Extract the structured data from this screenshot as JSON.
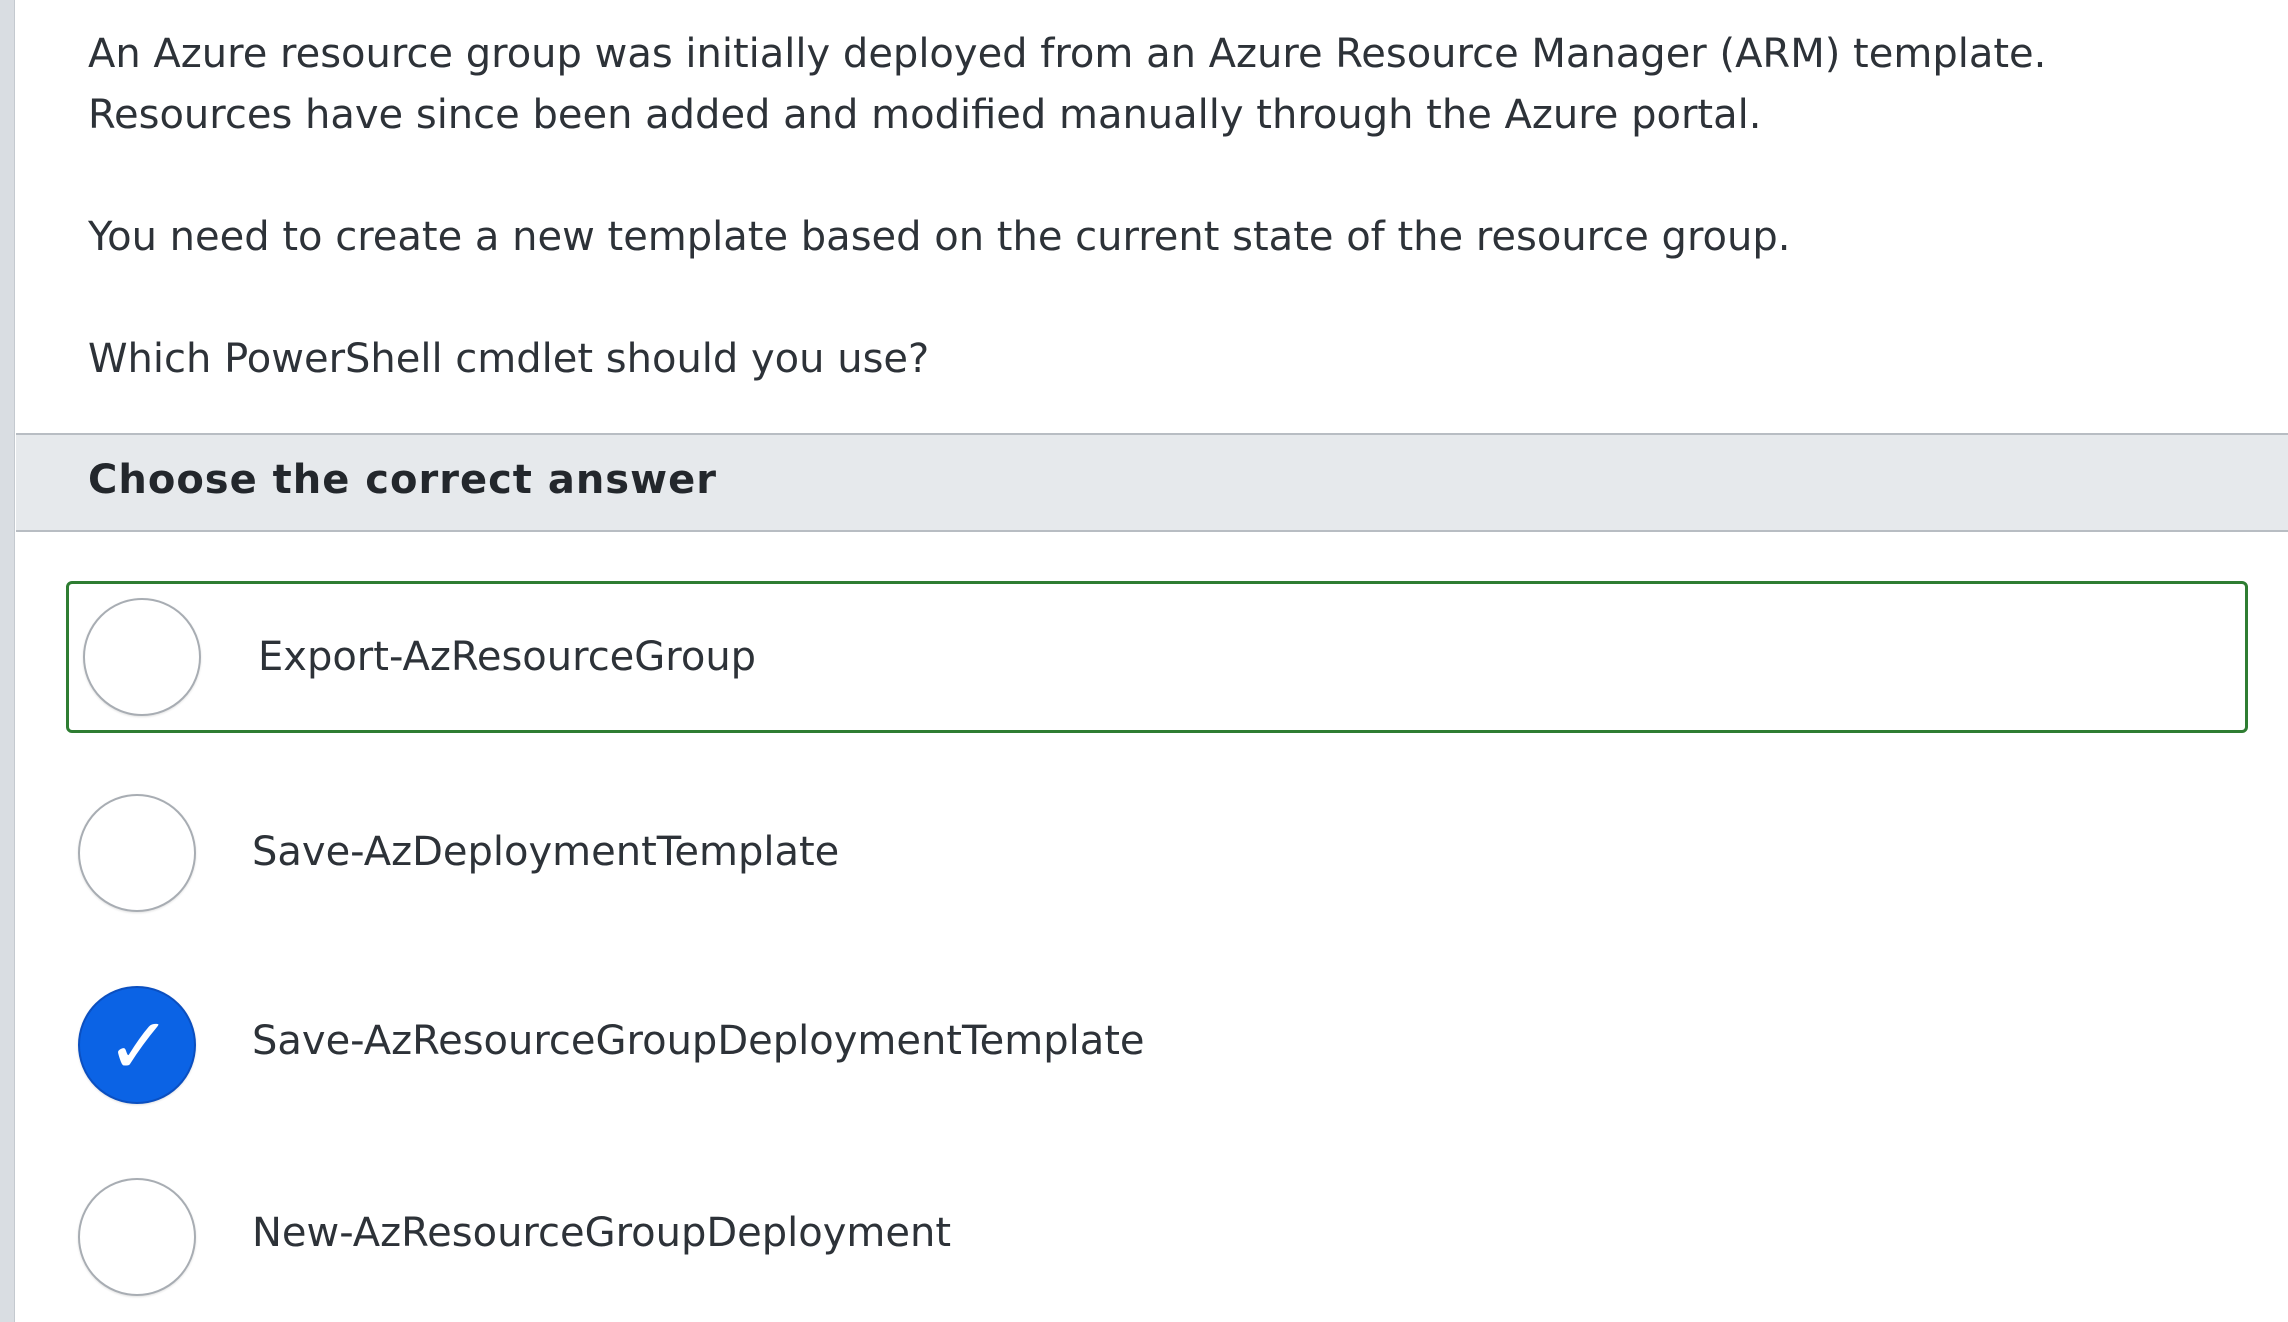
{
  "question": {
    "paragraphs": [
      "An Azure resource group was initially deployed from an Azure Resource Manager (ARM) template.",
      "Resources have since been added and modified manually through the Azure portal.",
      "You need to create a new template based on the current state of the resource group.",
      "Which PowerShell cmdlet should you use?"
    ]
  },
  "prompt": {
    "label": "Choose the correct answer"
  },
  "options": [
    {
      "label": "Export-AzResourceGroup",
      "selected": false,
      "highlighted": true
    },
    {
      "label": "Save-AzDeploymentTemplate",
      "selected": false,
      "highlighted": false
    },
    {
      "label": "Save-AzResourceGroupDeploymentTemplate",
      "selected": true,
      "highlighted": false
    },
    {
      "label": "New-AzResourceGroupDeployment",
      "selected": false,
      "highlighted": false
    }
  ],
  "check_glyph": "✓",
  "colors": {
    "selected_radio": "#0b63e5",
    "highlight_border": "#2e7d32",
    "prompt_bar": "#e6e9ec"
  }
}
